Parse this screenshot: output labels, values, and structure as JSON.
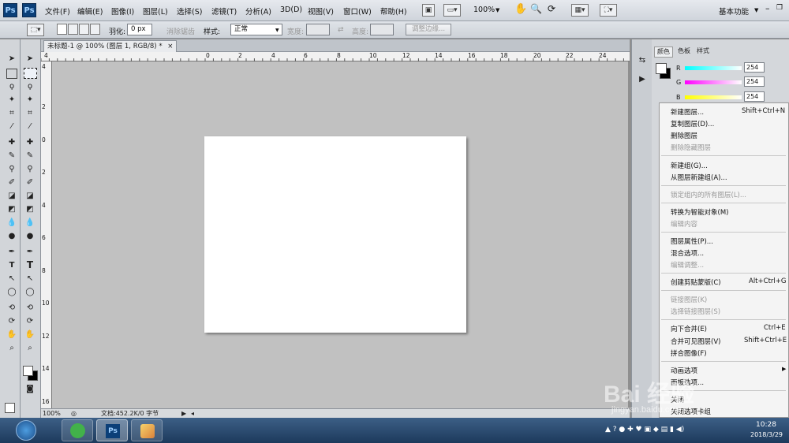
{
  "menubar": {
    "logo_left": "Ps",
    "logo_right": "Ps",
    "items": [
      "文件(F)",
      "编辑(E)",
      "图像(I)",
      "图层(L)",
      "选择(S)",
      "滤镜(T)",
      "分析(A)",
      "3D(D)",
      "视图(V)",
      "窗口(W)",
      "帮助(H)"
    ],
    "zoom": "100%",
    "workspace": "基本功能"
  },
  "options": {
    "feather_label": "羽化:",
    "feather_value": "0 px",
    "antialias_label": "消除锯齿",
    "style_label": "样式:",
    "style_value": "正常",
    "width_label": "宽度:",
    "height_label": "高度:",
    "refine_button": "调整边缘..."
  },
  "document": {
    "tab_title": "未标题-1 @ 100% (图层 1, RGB/8) *",
    "ruler_top": [
      "0",
      "2",
      "4",
      "6",
      "8",
      "10",
      "12",
      "14",
      "16",
      "18",
      "20",
      "22",
      "24"
    ],
    "ruler_top_neg": "4",
    "ruler_left": [
      "4",
      "2",
      "0",
      "2",
      "4",
      "6",
      "8",
      "10",
      "12",
      "14",
      "16",
      "18"
    ],
    "status_zoom": "100%",
    "status_doc": "文档:452.2K/0 字节"
  },
  "panel": {
    "tabs": [
      "颜色",
      "色板",
      "样式"
    ],
    "channels": [
      {
        "label": "R",
        "value": "254",
        "color": "#00e0e0"
      },
      {
        "label": "G",
        "value": "254",
        "color": "#e000e0"
      },
      {
        "label": "B",
        "value": "254",
        "color": "#e0e000"
      }
    ]
  },
  "context_menu": {
    "items": [
      {
        "label": "新建图层...",
        "shortcut": "Shift+Ctrl+N",
        "enabled": true
      },
      {
        "label": "复制图层(D)...",
        "shortcut": "",
        "enabled": true
      },
      {
        "label": "删除图层",
        "shortcut": "",
        "enabled": true
      },
      {
        "label": "删除隐藏图层",
        "shortcut": "",
        "enabled": false
      },
      {
        "label": "新建组(G)...",
        "shortcut": "",
        "enabled": true
      },
      {
        "label": "从图层新建组(A)...",
        "shortcut": "",
        "enabled": true
      },
      {
        "label": "锁定组内的所有图层(L)...",
        "shortcut": "",
        "enabled": false
      },
      {
        "label": "转换为智能对象(M)",
        "shortcut": "",
        "enabled": true
      },
      {
        "label": "编辑内容",
        "shortcut": "",
        "enabled": false
      },
      {
        "label": "图层属性(P)...",
        "shortcut": "",
        "enabled": true
      },
      {
        "label": "混合选项...",
        "shortcut": "",
        "enabled": true
      },
      {
        "label": "编辑调整...",
        "shortcut": "",
        "enabled": false
      },
      {
        "label": "创建剪贴蒙版(C)",
        "shortcut": "Alt+Ctrl+G",
        "enabled": true
      },
      {
        "label": "链接图层(K)",
        "shortcut": "",
        "enabled": false
      },
      {
        "label": "选择链接图层(S)",
        "shortcut": "",
        "enabled": false
      },
      {
        "label": "向下合并(E)",
        "shortcut": "Ctrl+E",
        "enabled": true
      },
      {
        "label": "合并可见图层(V)",
        "shortcut": "Shift+Ctrl+E",
        "enabled": true
      },
      {
        "label": "拼合图像(F)",
        "shortcut": "",
        "enabled": true
      },
      {
        "label": "动画选项",
        "shortcut": "",
        "enabled": true
      },
      {
        "label": "面板选项...",
        "shortcut": "",
        "enabled": true
      },
      {
        "label": "关闭",
        "shortcut": "",
        "enabled": true
      },
      {
        "label": "关闭选项卡组",
        "shortcut": "",
        "enabled": true
      }
    ]
  },
  "taskbar": {
    "ps_label": "Ps",
    "time": "10:28",
    "date": "2018/3/29"
  },
  "watermark": {
    "text": "Bai 经验",
    "url": "jingyan.baidu.com"
  },
  "colors": {
    "menubar": "#d9dde3",
    "canvas_area": "#c1c1c1",
    "canvas": "#ffffff",
    "taskbar": "#2a4a70"
  }
}
